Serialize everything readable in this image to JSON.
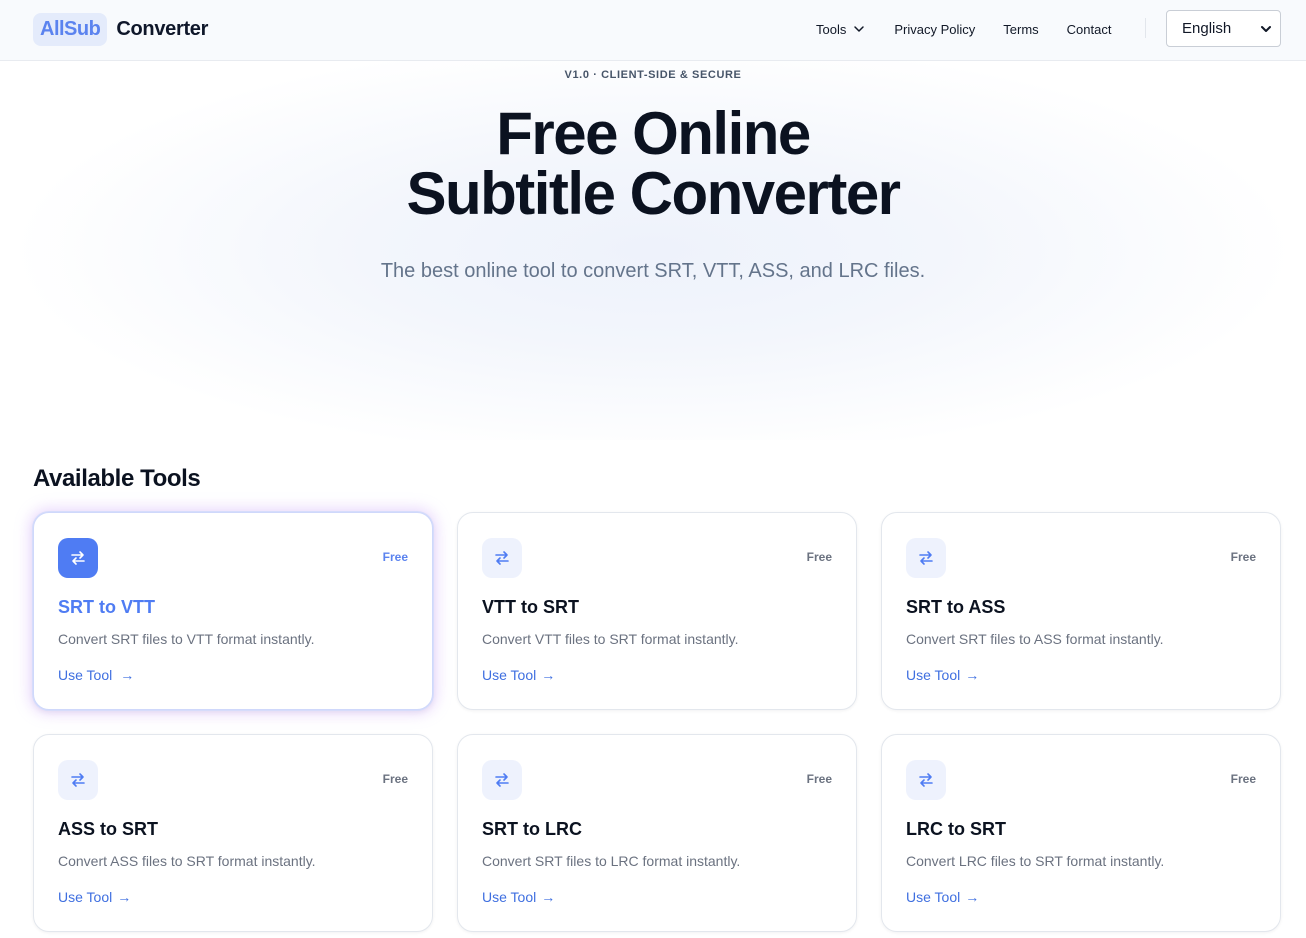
{
  "header": {
    "logo_badge": "AllSub",
    "logo_text": "Converter",
    "nav": {
      "tools": "Tools",
      "privacy": "Privacy Policy",
      "terms": "Terms",
      "contact": "Contact"
    },
    "language": "English"
  },
  "hero": {
    "tag": "V1.0 · CLIENT-SIDE & SECURE",
    "title_line1": "Free Online",
    "title_line2": "Subtitle Converter",
    "subtitle": "The best online tool to convert SRT, VTT, ASS, and LRC files."
  },
  "tools": {
    "section_title": "Available Tools",
    "cards": [
      {
        "title": "SRT to VTT",
        "description": "Convert SRT files to VTT format instantly.",
        "badge": "Free",
        "link": "Use Tool",
        "arrow": "→"
      },
      {
        "title": "VTT to SRT",
        "description": "Convert VTT files to SRT format instantly.",
        "badge": "Free",
        "link": "Use Tool",
        "arrow": "→"
      },
      {
        "title": "SRT to ASS",
        "description": "Convert SRT files to ASS format instantly.",
        "badge": "Free",
        "link": "Use Tool",
        "arrow": "→"
      },
      {
        "title": "ASS to SRT",
        "description": "Convert ASS files to SRT format instantly.",
        "badge": "Free",
        "link": "Use Tool",
        "arrow": "→"
      },
      {
        "title": "SRT to LRC",
        "description": "Convert SRT files to LRC format instantly.",
        "badge": "Free",
        "link": "Use Tool",
        "arrow": "→"
      },
      {
        "title": "LRC to SRT",
        "description": "Convert LRC files to SRT format instantly.",
        "badge": "Free",
        "link": "Use Tool",
        "arrow": "→"
      }
    ]
  },
  "colors": {
    "accent": "#4f7cf3",
    "link": "#3f6fe0",
    "heading": "#0b1220",
    "muted": "#64748b"
  },
  "icons": {
    "chevron": "chevron-down-icon",
    "tool": "swap-arrows-icon"
  }
}
